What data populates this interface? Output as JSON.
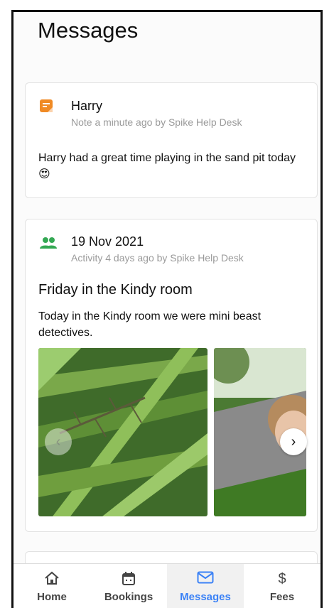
{
  "page": {
    "title": "Messages"
  },
  "note_card": {
    "title": "Harry",
    "subtitle": "Note a minute ago by Spike Help Desk",
    "body": "Harry had a great time playing in the sand pit today 😍",
    "icon": "note-icon",
    "icon_color": "#f08a24"
  },
  "activity_card": {
    "title": "19 Nov 2021",
    "subtitle": "Activity 4 days ago by Spike Help Desk",
    "heading": "Friday in the Kindy room",
    "body": "Today in the Kindy room we were mini beast detectives.",
    "icon": "group-icon",
    "icon_color": "#34a853",
    "carousel": {
      "prev": "‹",
      "next": "›"
    }
  },
  "tabs": [
    {
      "label": "Home",
      "icon": "home-icon"
    },
    {
      "label": "Bookings",
      "icon": "calendar-icon"
    },
    {
      "label": "Messages",
      "icon": "mail-icon",
      "active": true
    },
    {
      "label": "Fees",
      "icon": "dollar-icon",
      "symbol": "$"
    }
  ],
  "colors": {
    "accent": "#3b82f6"
  }
}
